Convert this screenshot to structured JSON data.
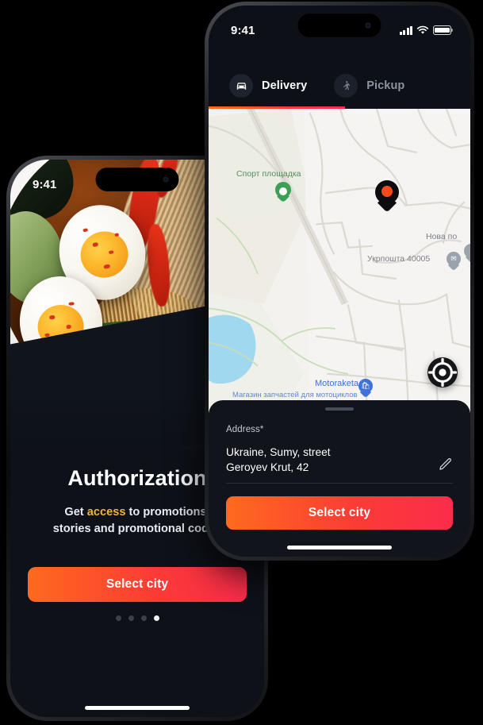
{
  "meta": {
    "scene": "Two iPhone mockups of a food-delivery app: left shows an Authorization onboarding screen, right shows a delivery-address map screen."
  },
  "left_phone": {
    "status_bar": {
      "time": "9:41",
      "icons": [
        "cellular-signal-icon",
        "wifi-icon",
        "battery-icon"
      ]
    },
    "photo": {
      "alt": "Ramen bowl with soft-boiled eggs, shredded chicken, chili oil and greens",
      "name": "food-photo"
    },
    "title": "Authorization",
    "subtitle_before": "Get ",
    "subtitle_highlight": "access",
    "subtitle_after": " to promotions,",
    "subtitle_line2": "stories and promotional codes",
    "cta_label": "Select city",
    "pagination": {
      "total": 4,
      "active_index": 3
    }
  },
  "right_phone": {
    "status_bar": {
      "time": "9:41",
      "icons": [
        "cellular-signal-icon",
        "wifi-icon",
        "battery-icon"
      ]
    },
    "tabs": [
      {
        "label": "Delivery",
        "icon": "car-icon",
        "active": true
      },
      {
        "label": "Pickup",
        "icon": "walking-person-icon",
        "active": false
      }
    ],
    "map": {
      "labels": [
        {
          "text": "Спорт площадка",
          "kind": "park"
        },
        {
          "text": "Нова по",
          "kind": "poi"
        },
        {
          "text": "Укрпошта 40005",
          "kind": "poi"
        },
        {
          "text": "Motoraketa",
          "kind": "shop"
        },
        {
          "text": "Магазин запчастей для мотоциклов",
          "kind": "shop-sub"
        }
      ],
      "selected_pin": "order-location-pin",
      "locate_button": "my-location-button"
    },
    "sheet": {
      "field_label": "Address*",
      "address_line1": "Ukraine, Sumy, street",
      "address_line2": "Geroyev Krut, 42",
      "edit_icon": "pencil-icon",
      "cta_label": "Select city"
    }
  },
  "colors": {
    "accent_start": "#FF6A1E",
    "accent_end": "#FB2C4C",
    "highlight": "#F2B33D",
    "panel": "#11141B",
    "map_bg": "#F3F2EF",
    "pin": "#FB4A1E"
  }
}
